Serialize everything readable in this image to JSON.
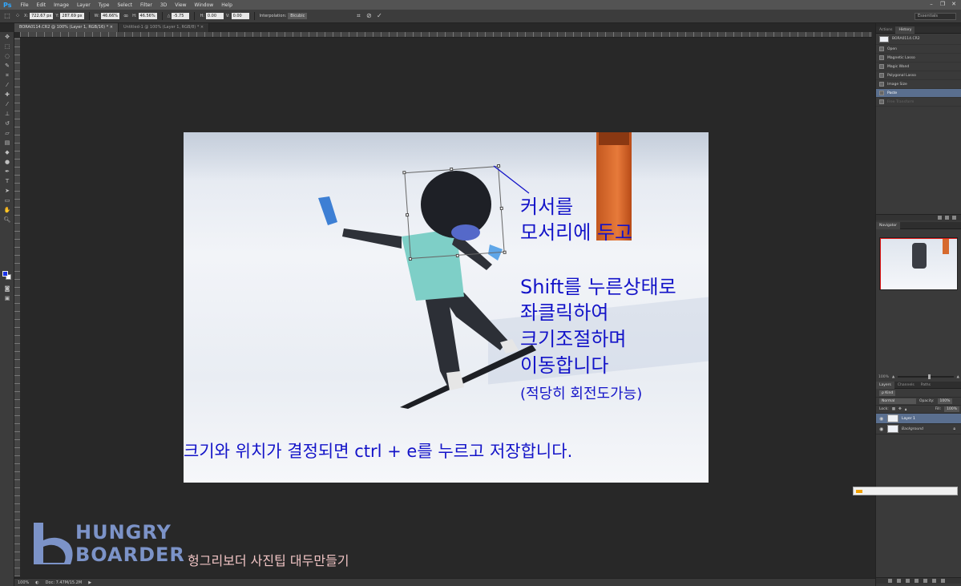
{
  "app": {
    "logo": "Ps"
  },
  "menu": [
    "File",
    "Edit",
    "Image",
    "Layer",
    "Type",
    "Select",
    "Filter",
    "3D",
    "View",
    "Window",
    "Help"
  ],
  "window_controls": [
    "–",
    "❐",
    "✕"
  ],
  "options_bar": {
    "x_label": "X:",
    "x_value": "722.67 px",
    "y_label": "Y:",
    "y_value": "287.69 px",
    "w_label": "W:",
    "w_value": "46.66%",
    "h_label": "H:",
    "h_value": "46.56%",
    "angle_label": "△",
    "angle_value": "-5.75",
    "hskew_label": "H:",
    "hskew_value": "0.00",
    "vskew_label": "V:",
    "vskew_value": "0.00",
    "interp_label": "Interpolation:",
    "interp_value": "Bicubic",
    "workspace": "Essentials"
  },
  "tabs": [
    {
      "label": "BORA0114.CR2 @ 100% (Layer 1, RGB/16) *  ×"
    },
    {
      "label": "Untitled-1 @ 100% (Layer 1, RGB/8) *  ×"
    }
  ],
  "annotations": {
    "step1_line1": "커서를",
    "step1_line2": "모서리에 두고",
    "step2_line1": "Shift를 누른상태로",
    "step2_line2": "좌클릭하여",
    "step2_line3": "크기조절하며",
    "step2_line4": "이동합니다",
    "step2_note": "(적당히 회전도가능)",
    "final": "크기와 위치가 결정되면 ctrl + e를 누르고 저장합니다."
  },
  "panels": {
    "history_tabs": [
      "Actions",
      "History"
    ],
    "history_snapshot": "BORA0114.CR2",
    "history_items": [
      {
        "label": "Open"
      },
      {
        "label": "Magnetic Lasso"
      },
      {
        "label": "Magic Wand"
      },
      {
        "label": "Polygonal Lasso"
      },
      {
        "label": "Image Size"
      },
      {
        "label": "Paste"
      },
      {
        "label": "Free Transform"
      }
    ],
    "navigator_tab": "Navigator",
    "zoom": "100%",
    "layers_tabs": [
      "Layers",
      "Channels",
      "Paths"
    ],
    "kind_label": "ρ Kind",
    "blend_mode": "Normal",
    "opacity_label": "Opacity:",
    "opacity_value": "100%",
    "lock_label": "Lock:",
    "fill_label": "Fill:",
    "fill_value": "100%",
    "layers": [
      {
        "name": "Layer 1"
      },
      {
        "name": "Background"
      }
    ]
  },
  "status": {
    "zoom": "100%",
    "doc": "Doc: 7.47M/15.2M"
  },
  "watermark": {
    "line1": "HUNGRY",
    "line2": "BOARDER",
    "caption": "헝그리보더 사진팁 대두만들기"
  },
  "colors": {
    "foreground": "#1a33e8",
    "background": "#ffffff",
    "annotation": "#1313c8"
  }
}
